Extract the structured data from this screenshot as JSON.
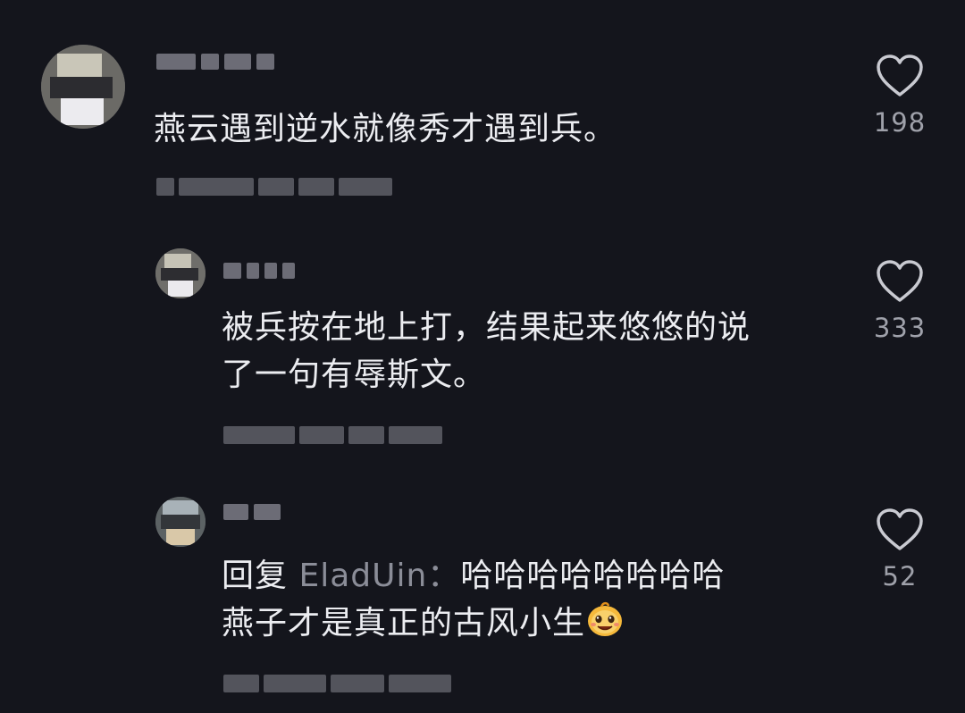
{
  "comments": [
    {
      "text": "燕云遇到逆水就像秀才遇到兵。",
      "likes": "198"
    },
    {
      "text": "被兵按在地上打，结果起来悠悠的说\n了一句有辱斯文。",
      "likes": "333"
    },
    {
      "reply_prefix": "回复",
      "reply_target": "EladUin：",
      "text_line1": "哈哈哈哈哈哈哈哈",
      "text_line2": "燕子才是真正的古风小生",
      "emoji": "grinning-face-emoji",
      "likes": "52"
    }
  ],
  "colors": {
    "background": "#14151c",
    "text": "#ecedf1",
    "muted": "#9fa1aa",
    "mention": "#8b8d98"
  },
  "icons": {
    "like": "heart-outline-icon"
  }
}
